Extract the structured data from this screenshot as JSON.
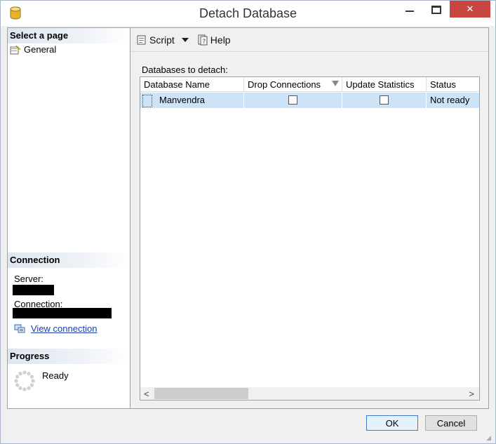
{
  "window": {
    "title": "Detach Database",
    "close_glyph": "✕",
    "accent_close": "#c7463f"
  },
  "left": {
    "select_page_title": "Select a page",
    "pages": [
      {
        "label": "General",
        "icon": "page-settings-icon"
      }
    ],
    "connection_title": "Connection",
    "server_label": "Server:",
    "connection_label": "Connection:",
    "view_connection_label": "View connection",
    "progress_title": "Progress",
    "progress_status": "Ready"
  },
  "toolbar": {
    "script_label": "Script",
    "help_label": "Help"
  },
  "content": {
    "label": "Databases to detach:",
    "columns": [
      "Database Name",
      "Drop Connections",
      "Update Statistics",
      "Status"
    ],
    "rows": [
      {
        "database_name": "Manvendra",
        "drop_connections": false,
        "update_statistics": false,
        "status": "Not ready"
      }
    ],
    "selection_color": "#cce3f8"
  },
  "footer": {
    "ok_label": "OK",
    "cancel_label": "Cancel"
  }
}
